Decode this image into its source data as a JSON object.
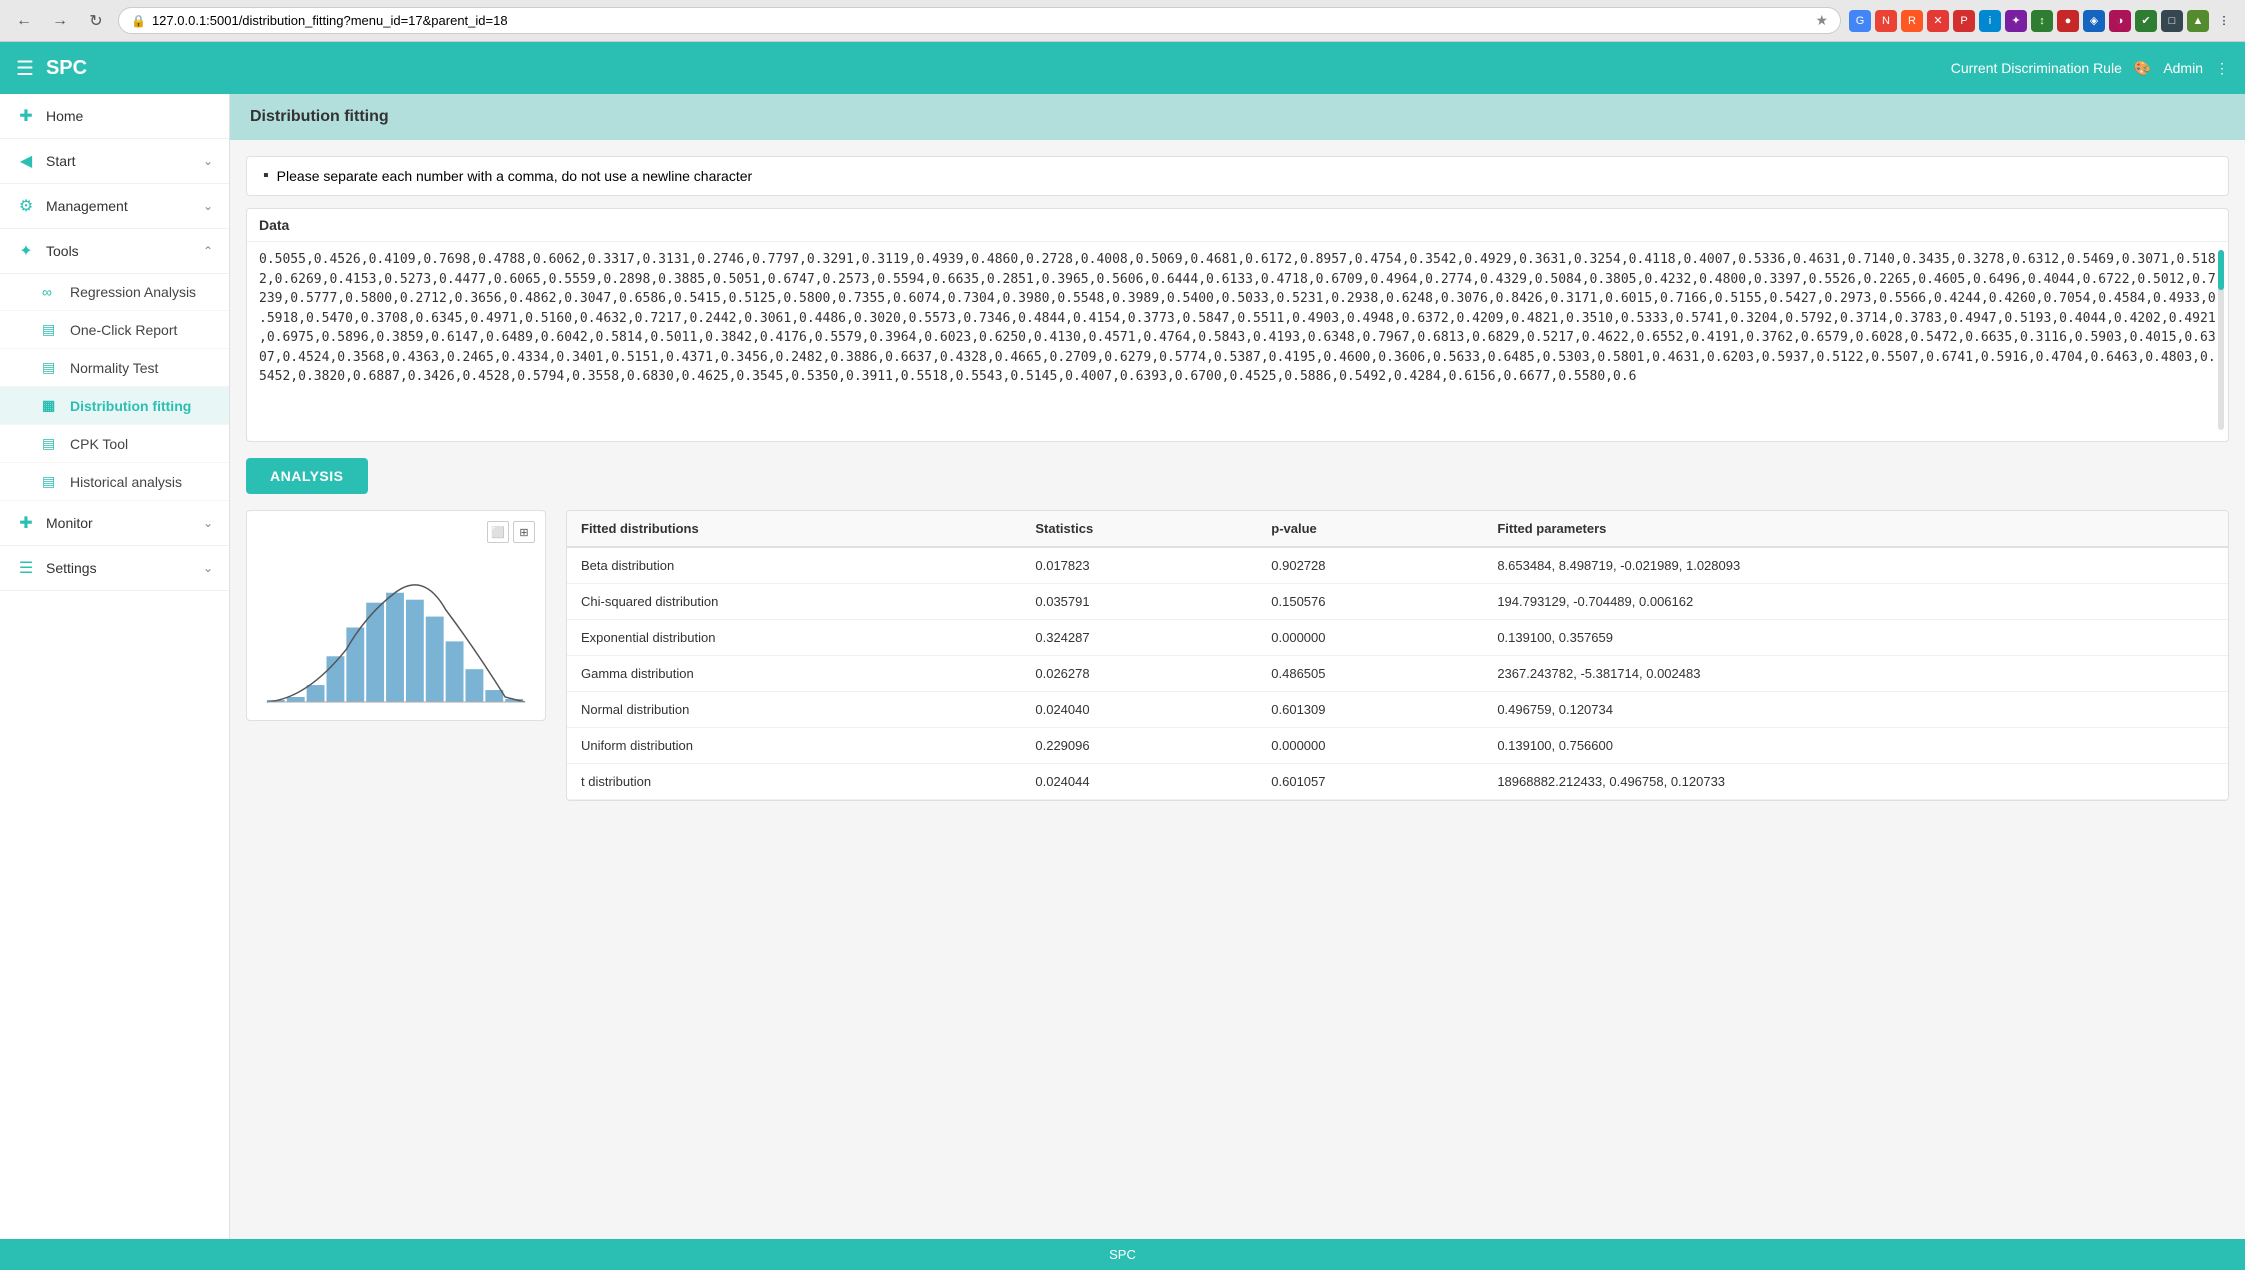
{
  "browser": {
    "url": "127.0.0.1:5001/distribution_fitting?menu_id=17&parent_id=18",
    "back_title": "Back",
    "forward_title": "Forward",
    "refresh_title": "Refresh"
  },
  "app_header": {
    "menu_icon": "☰",
    "logo": "SPC",
    "discrimination_rule_label": "Current Discrimination Rule",
    "user_label": "Admin",
    "palette_icon": "🎨"
  },
  "sidebar": {
    "items": [
      {
        "id": "home",
        "icon": "✚",
        "label": "Home",
        "has_chevron": false,
        "active": false
      },
      {
        "id": "start",
        "icon": "◀",
        "label": "Start",
        "has_chevron": true,
        "active": false
      },
      {
        "id": "management",
        "icon": "⚙",
        "label": "Management",
        "has_chevron": true,
        "active": false
      },
      {
        "id": "tools",
        "icon": "✦",
        "label": "Tools",
        "has_chevron": true,
        "active": false,
        "expanded": true
      }
    ],
    "sub_items": [
      {
        "id": "regression",
        "icon": "∞",
        "label": "Regression Analysis",
        "active": false
      },
      {
        "id": "one-click",
        "icon": "▤",
        "label": "One-Click Report",
        "active": false
      },
      {
        "id": "normality",
        "icon": "▤",
        "label": "Normality Test",
        "active": false
      },
      {
        "id": "dist-fitting",
        "icon": "▦",
        "label": "Distribution fitting",
        "active": true
      },
      {
        "id": "cpk",
        "icon": "▤",
        "label": "CPK Tool",
        "active": false
      },
      {
        "id": "historical",
        "icon": "▤",
        "label": "Historical analysis",
        "active": false
      }
    ],
    "bottom_items": [
      {
        "id": "monitor",
        "icon": "✚",
        "label": "Monitor",
        "has_chevron": true
      },
      {
        "id": "settings",
        "icon": "☰",
        "label": "Settings",
        "has_chevron": true
      }
    ]
  },
  "page": {
    "title": "Distribution fitting",
    "instruction": "Please separate each number with a comma, do not use a newline character",
    "data_label": "Data",
    "data_value": "0.5055,0.4526,0.4109,0.7698,0.4788,0.6062,0.3317,0.3131,0.2746,0.7797,0.3291,0.3119,0.4939,0.4860,0.2728,0.4008,0.5069,0.4681,0.6172,0.8957,0.4754,0.3542,0.4929,0.3631,0.3254,0.4118,0.4007,0.5336,0.4631,0.7140,0.3435,0.3278,0.6312,0.5469,0.3071,0.5182,0.6269,0.4153,0.5273,0.4477,0.6065,0.5559,0.2898,0.3885,0.5051,0.6747,0.2573,0.5594,0.6635,0.2851,0.3965,0.5606,0.6444,0.6133,0.4718,0.6709,0.4964,0.2774,0.4329,0.5084,0.3805,0.4232,0.4800,0.3397,0.5526,0.2265,0.4605,0.6496,0.4044,0.6722,0.5012,0.7239,0.5777,0.5800,0.2712,0.3656,0.4862,0.3047,0.6586,0.5415,0.5125,0.5800,0.7355,0.6074,0.7304,0.3980,0.5548,0.3989,0.5400,0.5033,0.5231,0.2938,0.6248,0.3076,0.8426,0.3171,0.6015,0.7166,0.5155,0.5427,0.2973,0.5566,0.4244,0.4260,0.7054,0.4584,0.4933,0.5918,0.5470,0.3708,0.6345,0.4971,0.5160,0.4632,0.7217,0.2442,0.3061,0.4486,0.3020,0.5573,0.7346,0.4844,0.4154,0.3773,0.5847,0.5511,0.4903,0.4948,0.6372,0.4209,0.4821,0.3510,0.5333,0.5741,0.3204,0.5792,0.3714,0.3783,0.4947,0.5193,0.4044,0.4202,0.4921,0.6975,0.5896,0.3859,0.6147,0.6489,0.6042,0.5814,0.5011,0.3842,0.4176,0.5579,0.3964,0.6023,0.6250,0.4130,0.4571,0.4764,0.5843,0.4193,0.6348,0.7967,0.6813,0.6829,0.5217,0.4622,0.6552,0.4191,0.3762,0.6579,0.6028,0.5472,0.6635,0.3116,0.5903,0.4015,0.6307,0.4524,0.3568,0.4363,0.2465,0.4334,0.3401,0.5151,0.4371,0.3456,0.2482,0.3886,0.6637,0.4328,0.4665,0.2709,0.6279,0.5774,0.5387,0.4195,0.4600,0.3606,0.5633,0.6485,0.5303,0.5801,0.4631,0.6203,0.5937,0.5122,0.5507,0.6741,0.5916,0.4704,0.6463,0.4803,0.5452,0.3820,0.6887,0.3426,0.4528,0.5794,0.3558,0.6830,0.4625,0.3545,0.5350,0.3911,0.5518,0.5543,0.5145,0.4007,0.6393,0.6700,0.4525,0.5886,0.5492,0.4284,0.6156,0.6677,0.5580,0.6",
    "analysis_button": "ANALYSIS",
    "table_headers": {
      "distribution": "Fitted distributions",
      "statistics": "Statistics",
      "pvalue": "p-value",
      "parameters": "Fitted parameters"
    },
    "table_rows": [
      {
        "distribution": "Beta distribution",
        "statistics": "0.017823",
        "pvalue": "0.902728",
        "parameters": "8.653484, 8.498719, -0.021989, 1.028093"
      },
      {
        "distribution": "Chi-squared distribution",
        "statistics": "0.035791",
        "pvalue": "0.150576",
        "parameters": "194.793129, -0.704489, 0.006162"
      },
      {
        "distribution": "Exponential distribution",
        "statistics": "0.324287",
        "pvalue": "0.000000",
        "parameters": "0.139100, 0.357659"
      },
      {
        "distribution": "Gamma distribution",
        "statistics": "0.026278",
        "pvalue": "0.486505",
        "parameters": "2367.243782, -5.381714, 0.002483"
      },
      {
        "distribution": "Normal distribution",
        "statistics": "0.024040",
        "pvalue": "0.601309",
        "parameters": "0.496759, 0.120734"
      },
      {
        "distribution": "Uniform distribution",
        "statistics": "0.229096",
        "pvalue": "0.000000",
        "parameters": "0.139100, 0.756600"
      },
      {
        "distribution": "t distribution",
        "statistics": "0.024044",
        "pvalue": "0.601057",
        "parameters": "18968882.212433, 0.496758, 0.120733"
      }
    ]
  },
  "footer": {
    "label": "SPC"
  },
  "histogram": {
    "bars": [
      1,
      3,
      8,
      18,
      30,
      42,
      48,
      44,
      36,
      22,
      12,
      5,
      2
    ],
    "color": "#7ab3d4"
  }
}
